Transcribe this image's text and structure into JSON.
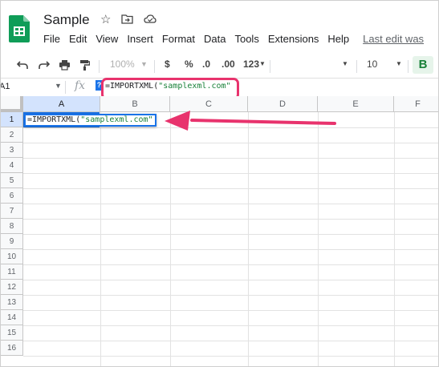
{
  "doc": {
    "title": "Sample",
    "icons": [
      "star-icon",
      "move-to-folder-icon",
      "cloud-status-icon"
    ]
  },
  "menu": [
    "File",
    "Edit",
    "View",
    "Insert",
    "Format",
    "Data",
    "Tools",
    "Extensions",
    "Help"
  ],
  "last_edit": "Last edit was",
  "toolbar": {
    "zoom": "100%",
    "currency": "$",
    "percent": "%",
    "decrease_decimal": ".0",
    "increase_decimal": ".00",
    "more_formats": "123",
    "font_size": "10",
    "bold": "B"
  },
  "formula_bar": {
    "name_box": "A1",
    "fx": "fx",
    "help": "?",
    "func": "=IMPORTXML(",
    "arg": "\"samplexml.com\""
  },
  "cell_editor": {
    "func": "=IMPORTXML(",
    "arg": "\"samplexml.com\""
  },
  "columns": [
    "A",
    "B",
    "C",
    "D",
    "E",
    "F"
  ],
  "rows": [
    "1",
    "2",
    "3",
    "4",
    "5",
    "6",
    "7",
    "8",
    "9",
    "10",
    "11",
    "12",
    "13",
    "14",
    "15",
    "16"
  ],
  "colors": {
    "highlight": "#e8336d",
    "selection": "#1a73e8",
    "string_literal": "#188038",
    "sheets_green": "#0f9d58"
  }
}
